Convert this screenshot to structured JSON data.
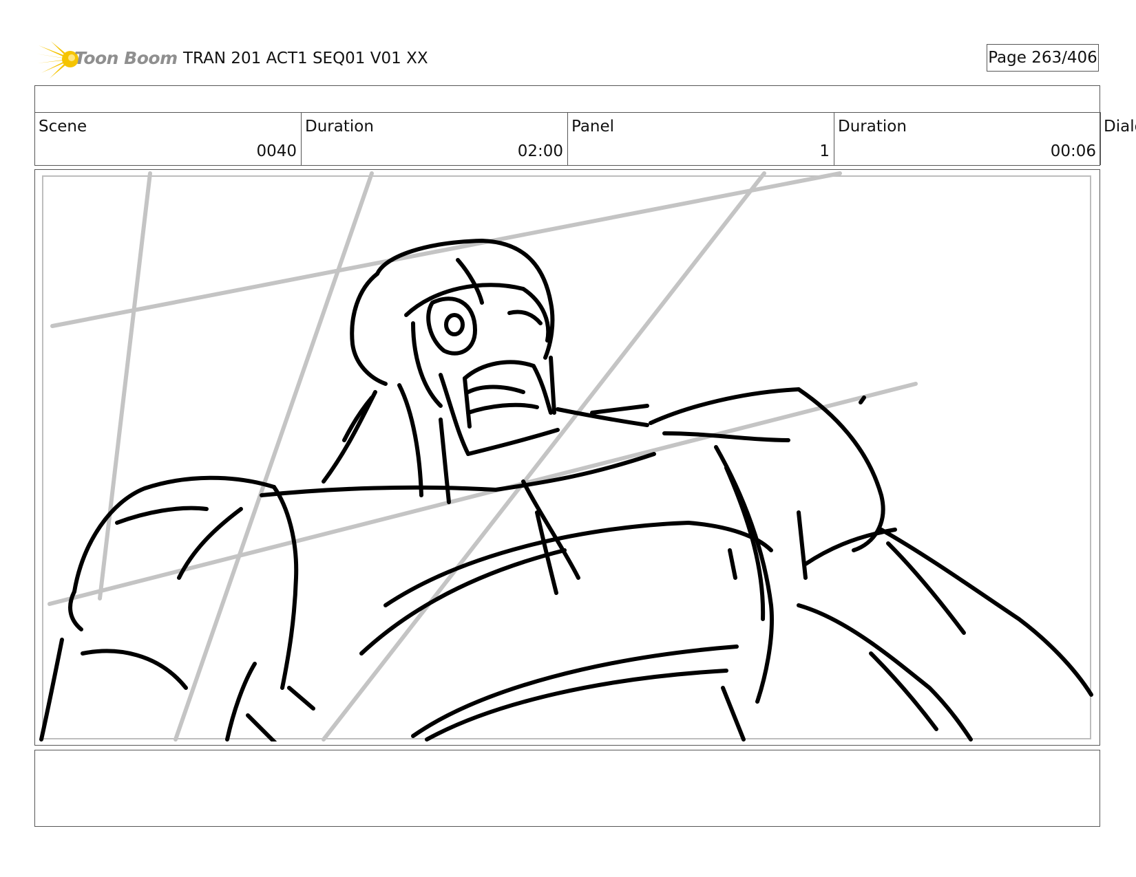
{
  "header": {
    "brand": "Toon Boom",
    "title": "TRAN 201 ACT1 SEQ01 V01 XX",
    "page": "Page 263/406"
  },
  "info": {
    "scene_label": "Scene",
    "scene_value": "0040",
    "duration_label": "Duration",
    "duration_value": "02:00",
    "panel_label": "Panel",
    "panel_value": "1",
    "panel_duration_label": "Duration",
    "panel_duration_value": "00:06",
    "dialog_label": "Dialo"
  },
  "icons": {
    "logo": "toon-boom-sun-icon"
  },
  "colors": {
    "logo_yellow": "#f5c400",
    "logo_text": "#8f8f8f",
    "guide_lines": "#c4c4c4",
    "sketch": "#000000"
  }
}
